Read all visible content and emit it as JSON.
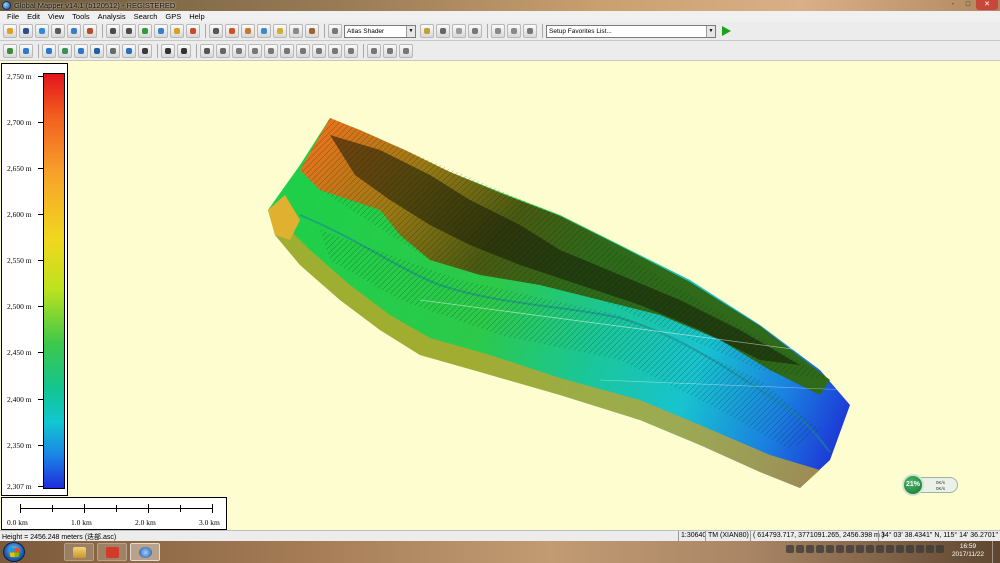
{
  "window": {
    "title": "Global Mapper v14.1 (b120512) - REGISTERED"
  },
  "window_controls": [
    "-",
    "□",
    "✕"
  ],
  "menu": [
    "File",
    "Edit",
    "View",
    "Tools",
    "Analysis",
    "Search",
    "GPS",
    "Help"
  ],
  "toolbar": {
    "shader_select": "Atlas Shader",
    "favorites_select": "Setup Favorites List..."
  },
  "icons": {
    "toolbar1": [
      "open-folder-icon",
      "save-icon",
      "globe-icon",
      "config-icon",
      "overlay-control-icon",
      "draw-icon",
      "zoom-in-icon",
      "zoom-out-icon",
      "zoom-full-icon",
      "zoom-layer-icon",
      "pan-icon",
      "home-icon",
      "select-icon",
      "digitizer-icon",
      "measure-icon",
      "feature-info-icon",
      "path-profile-icon",
      "view-shed-icon",
      "3d-view-icon",
      "shader-toggle-icon",
      "lighting-icon",
      "clip-icon",
      "gps-icon"
    ],
    "toolbar2": [
      "contour-icon",
      "watershed-icon",
      "terrain-analysis-icon",
      "grid-icon",
      "lidar-icon",
      "measure-volume-icon",
      "cut-fill-icon",
      "elevation-grid-icon",
      "mesh-icon",
      "slope-icon",
      "aspect-icon",
      "combine-icon",
      "layer-tool-icon",
      "feature-a-icon",
      "feature-b-icon",
      "feature-c-icon",
      "feature-d-icon",
      "feature-e-icon",
      "feature-f-icon",
      "feature-g-icon",
      "feature-h-icon",
      "feature-i-icon"
    ]
  },
  "legend": {
    "ticks": [
      "2,750 m",
      "2,700 m",
      "2,650 m",
      "2,600 m",
      "2,550 m",
      "2,500 m",
      "2,450 m",
      "2,400 m",
      "2,350 m",
      "2,307 m"
    ],
    "colors": [
      "#e3141b",
      "#f25d1f",
      "#f7a22a",
      "#f1d71e",
      "#bde21e",
      "#3dc84a",
      "#13c590",
      "#12c7cf",
      "#1b86e6",
      "#1f2cdb"
    ]
  },
  "scale_bar": {
    "labels": [
      "0.0 km",
      "1.0 km",
      "2.0 km",
      "3.0 km"
    ]
  },
  "network_widget": {
    "percent": "21%",
    "upload": "0K/s",
    "download": "0K/s"
  },
  "status_bar": {
    "height_text": "Height = 2456.248 meters (迭部.asc)",
    "scale": "1:30640",
    "projection": "TM (XIAN80)",
    "projected_coords": "( 614793.717, 3771091.265, 2456.398 m )",
    "geo_coords": "34° 03' 38.4341\" N, 115° 14' 36.2701\" E"
  },
  "taskbar": {
    "apps": [
      "explorer",
      "foxit-reader",
      "global-mapper"
    ],
    "clock_time": "16:59",
    "clock_date": "2017/11/22"
  }
}
